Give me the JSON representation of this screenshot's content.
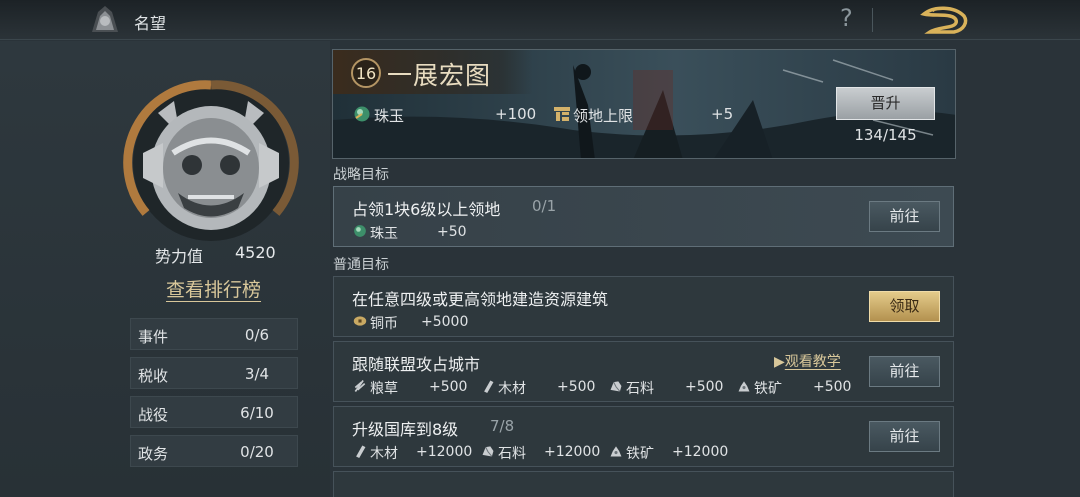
{
  "header": {
    "title": "名望",
    "help_glyph": "?"
  },
  "profile": {
    "power_label": "势力值",
    "power_value": "4520",
    "ranking_link": "查看排行榜",
    "stats": [
      {
        "name": "事件",
        "value": "0/6"
      },
      {
        "name": "税收",
        "value": "3/4"
      },
      {
        "name": "战役",
        "value": "6/10"
      },
      {
        "name": "政务",
        "value": "0/20"
      }
    ]
  },
  "banner": {
    "level": "16",
    "title": "一展宏图",
    "rewards": [
      {
        "icon": "jade-icon",
        "name": "珠玉",
        "amount": "+100"
      },
      {
        "icon": "territory-cap-icon",
        "name": "领地上限",
        "amount": "+5"
      }
    ],
    "promote_button": "晋升",
    "progress": "134/145"
  },
  "strategic": {
    "section_title": "战略目标",
    "goal": {
      "title": "占领1块6级以上领地",
      "progress": "0/1",
      "rewards": [
        {
          "icon": "jade-icon",
          "name": "珠玉",
          "amount": "+50"
        }
      ],
      "button": "前往"
    }
  },
  "normal": {
    "section_title": "普通目标",
    "goals": [
      {
        "title": "在任意四级或更高领地建造资源建筑",
        "progress": "",
        "rewards": [
          {
            "icon": "copper-coin-icon",
            "name": "铜币",
            "amount": "+5000"
          }
        ],
        "button": "领取"
      },
      {
        "title": "跟随联盟攻占城市",
        "progress": "",
        "tutorial": "观看教学",
        "rewards": [
          {
            "icon": "grain-icon",
            "name": "粮草",
            "amount": "+500"
          },
          {
            "icon": "wood-icon",
            "name": "木材",
            "amount": "+500"
          },
          {
            "icon": "stone-icon",
            "name": "石料",
            "amount": "+500"
          },
          {
            "icon": "iron-ore-icon",
            "name": "铁矿",
            "amount": "+500"
          }
        ],
        "button": "前往"
      },
      {
        "title": "升级国库到8级",
        "progress": "7/8",
        "rewards": [
          {
            "icon": "wood-icon",
            "name": "木材",
            "amount": "+12000"
          },
          {
            "icon": "stone-icon",
            "name": "石料",
            "amount": "+12000"
          },
          {
            "icon": "iron-ore-icon",
            "name": "铁矿",
            "amount": "+12000"
          }
        ],
        "button": "前往"
      }
    ]
  },
  "colors": {
    "accent_gold": "#d8c79a",
    "claim_gold": "#c9a963",
    "panel": "#2e383d",
    "background": "#2a3339"
  }
}
